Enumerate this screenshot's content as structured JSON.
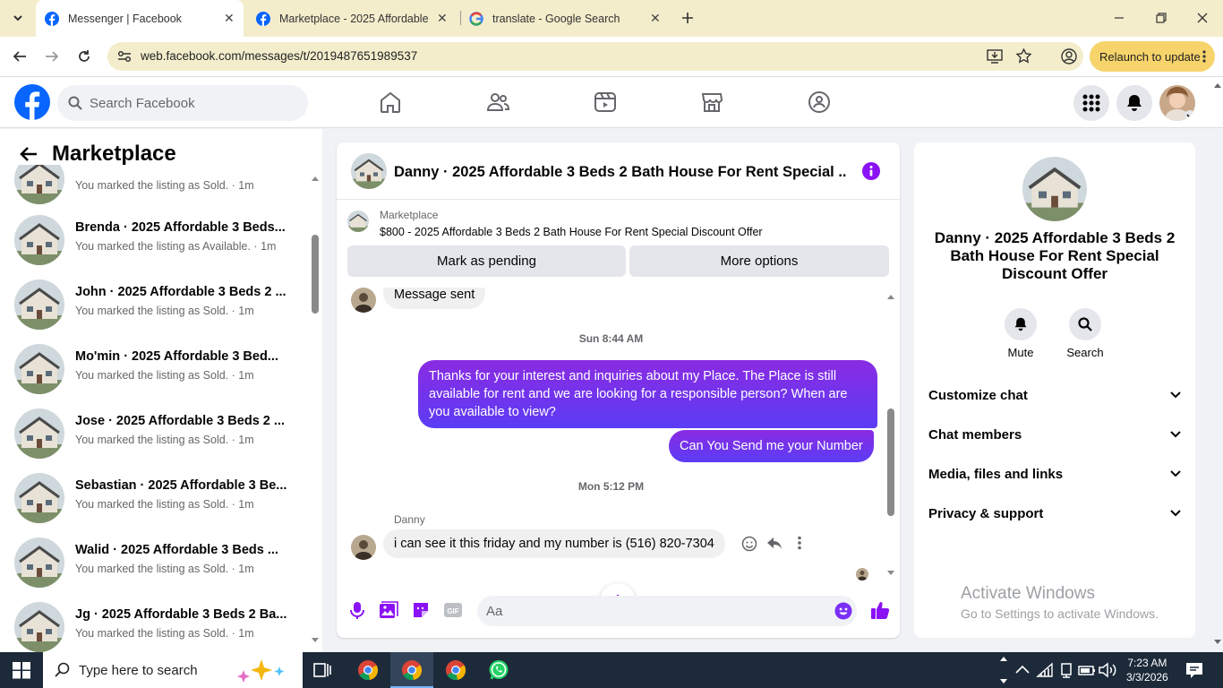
{
  "browser": {
    "tabs": [
      {
        "label": "Messenger | Facebook",
        "active": true
      },
      {
        "label": "Marketplace - 2025 Affordable",
        "active": false
      },
      {
        "label": "translate - Google Search",
        "active": false
      }
    ],
    "url": "web.facebook.com/messages/t/2019487651989537",
    "relaunch_label": "Relaunch to update"
  },
  "facebook": {
    "search_placeholder": "Search Facebook"
  },
  "left": {
    "title": "Marketplace",
    "items": [
      {
        "name": "",
        "sub": "You marked the listing as Sold. · 1m"
      },
      {
        "name": "Brenda · 2025 Affordable 3 Beds...",
        "sub": "You marked the listing as Available. · 1m"
      },
      {
        "name": "John · 2025 Affordable 3 Beds 2 ...",
        "sub": "You marked the listing as Sold. · 1m"
      },
      {
        "name": "Mo'min · 2025 Affordable 3 Bed...",
        "sub": "You marked the listing as Sold. · 1m"
      },
      {
        "name": "Jose · 2025 Affordable 3 Beds 2 ...",
        "sub": "You marked the listing as Sold. · 1m"
      },
      {
        "name": "Sebastian · 2025 Affordable 3 Be...",
        "sub": "You marked the listing as Sold. · 1m"
      },
      {
        "name": "Walid · 2025 Affordable 3 Beds ...",
        "sub": "You marked the listing as Sold. · 1m"
      },
      {
        "name": "Jg · 2025 Affordable 3 Beds 2 Ba...",
        "sub": "You marked the listing as Sold. · 1m"
      }
    ]
  },
  "chat": {
    "title": "Danny · 2025 Affordable 3 Beds 2 Bath House For Rent Special ...",
    "listing_source": "Marketplace",
    "listing_desc": "$800 - 2025 Affordable 3 Beds 2 Bath House For Rent Special Discount Offer",
    "btn_pending": "Mark as pending",
    "btn_more": "More options",
    "msg_sent": "Message sent",
    "ts1": "Sun 8:44 AM",
    "out1": "Thanks for your interest and inquiries about my Place. The Place is still available for rent and we are looking for a responsible person? When are you available to view?",
    "out2": "Can You Send me your Number",
    "ts2": "Mon 5:12 PM",
    "sender": "Danny",
    "in1": "i can see it this friday and my number is (516) 820-7304",
    "composer_placeholder": "Aa"
  },
  "right": {
    "name": "Danny · 2025 Affordable 3 Beds 2 Bath House For Rent Special Discount Offer",
    "mute": "Mute",
    "search": "Search",
    "sections": [
      "Customize chat",
      "Chat members",
      "Media, files and links",
      "Privacy & support"
    ]
  },
  "watermark": {
    "line1": "Activate Windows",
    "line2": "Go to Settings to activate Windows."
  },
  "taskbar": {
    "search_placeholder": "Type here to search",
    "time": "7:23 AM",
    "date": "3/3/2026"
  },
  "colors": {
    "facebook_blue": "#0866ff",
    "messenger_purple": "#7b2ff7",
    "relaunch_yellow": "#f6d46b"
  }
}
